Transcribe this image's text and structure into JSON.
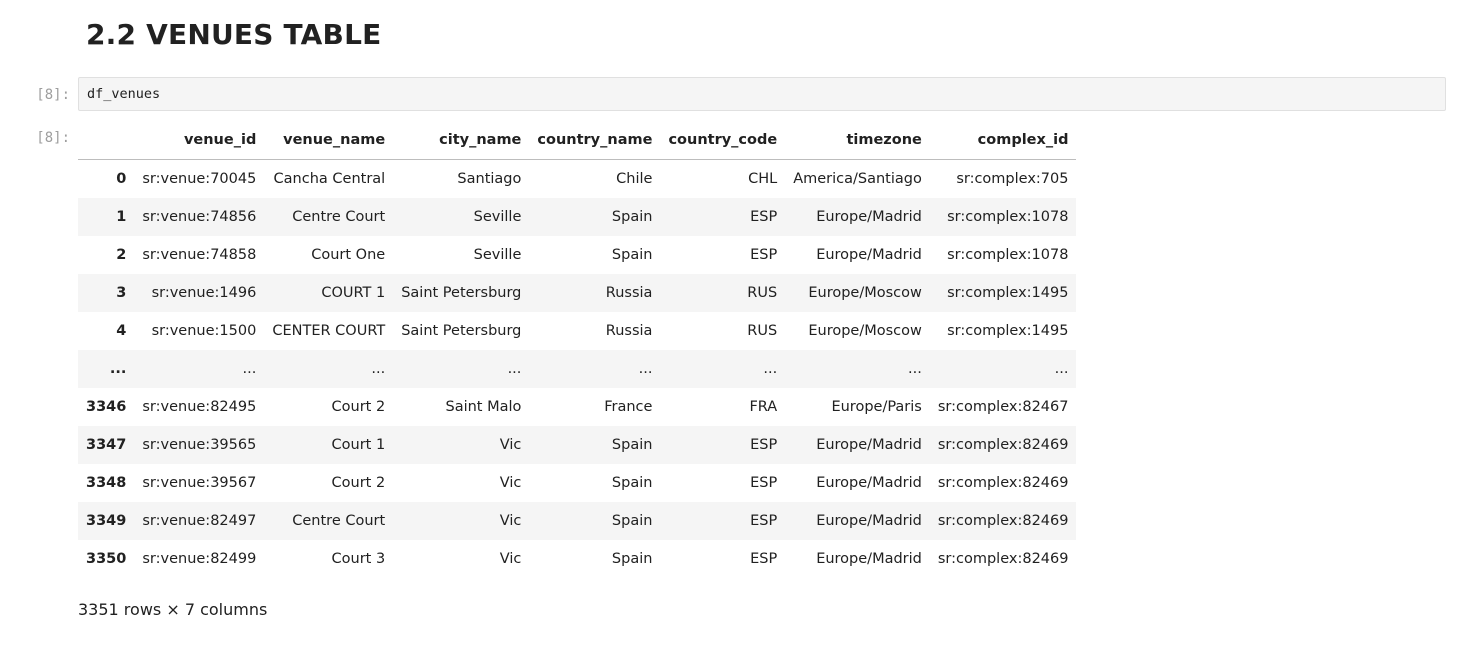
{
  "heading": "2.2 VENUES TABLE",
  "input_prompt": "[8]:",
  "output_prompt": "[8]:",
  "code": "df_venues",
  "table": {
    "columns": [
      "",
      "venue_id",
      "venue_name",
      "city_name",
      "country_name",
      "country_code",
      "timezone",
      "complex_id"
    ],
    "rows": [
      [
        "0",
        "sr:venue:70045",
        "Cancha Central",
        "Santiago",
        "Chile",
        "CHL",
        "America/Santiago",
        "sr:complex:705"
      ],
      [
        "1",
        "sr:venue:74856",
        "Centre Court",
        "Seville",
        "Spain",
        "ESP",
        "Europe/Madrid",
        "sr:complex:1078"
      ],
      [
        "2",
        "sr:venue:74858",
        "Court One",
        "Seville",
        "Spain",
        "ESP",
        "Europe/Madrid",
        "sr:complex:1078"
      ],
      [
        "3",
        "sr:venue:1496",
        "COURT 1",
        "Saint Petersburg",
        "Russia",
        "RUS",
        "Europe/Moscow",
        "sr:complex:1495"
      ],
      [
        "4",
        "sr:venue:1500",
        "CENTER COURT",
        "Saint Petersburg",
        "Russia",
        "RUS",
        "Europe/Moscow",
        "sr:complex:1495"
      ],
      [
        "...",
        "...",
        "...",
        "...",
        "...",
        "...",
        "...",
        "..."
      ],
      [
        "3346",
        "sr:venue:82495",
        "Court 2",
        "Saint Malo",
        "France",
        "FRA",
        "Europe/Paris",
        "sr:complex:82467"
      ],
      [
        "3347",
        "sr:venue:39565",
        "Court 1",
        "Vic",
        "Spain",
        "ESP",
        "Europe/Madrid",
        "sr:complex:82469"
      ],
      [
        "3348",
        "sr:venue:39567",
        "Court 2",
        "Vic",
        "Spain",
        "ESP",
        "Europe/Madrid",
        "sr:complex:82469"
      ],
      [
        "3349",
        "sr:venue:82497",
        "Centre Court",
        "Vic",
        "Spain",
        "ESP",
        "Europe/Madrid",
        "sr:complex:82469"
      ],
      [
        "3350",
        "sr:venue:82499",
        "Court 3",
        "Vic",
        "Spain",
        "ESP",
        "Europe/Madrid",
        "sr:complex:82469"
      ]
    ]
  },
  "summary": "3351 rows × 7 columns"
}
